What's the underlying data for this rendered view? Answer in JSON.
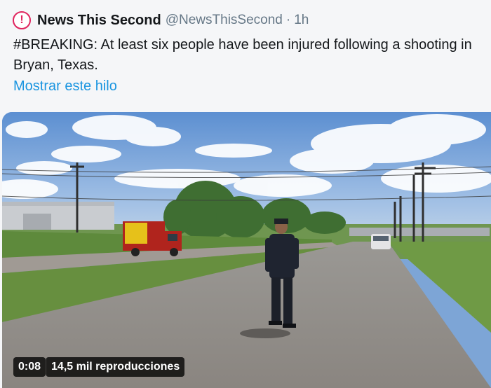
{
  "tweet": {
    "display_name": "News This Second",
    "handle": "@NewsThisSecond",
    "separator": "·",
    "time": "1h",
    "avatar_icon": "exclamation-circle-icon",
    "avatar_mark": "!",
    "text": "#BREAKING: At least six people have been injured following a shooting in Bryan, Texas.",
    "thread_link": "Mostrar este hilo"
  },
  "video": {
    "duration": "0:08",
    "views": "14,5 mil reproducciones"
  },
  "colors": {
    "accent_link": "#1b95e0",
    "avatar_ring": "#e0245e",
    "secondary_text": "#657786"
  }
}
